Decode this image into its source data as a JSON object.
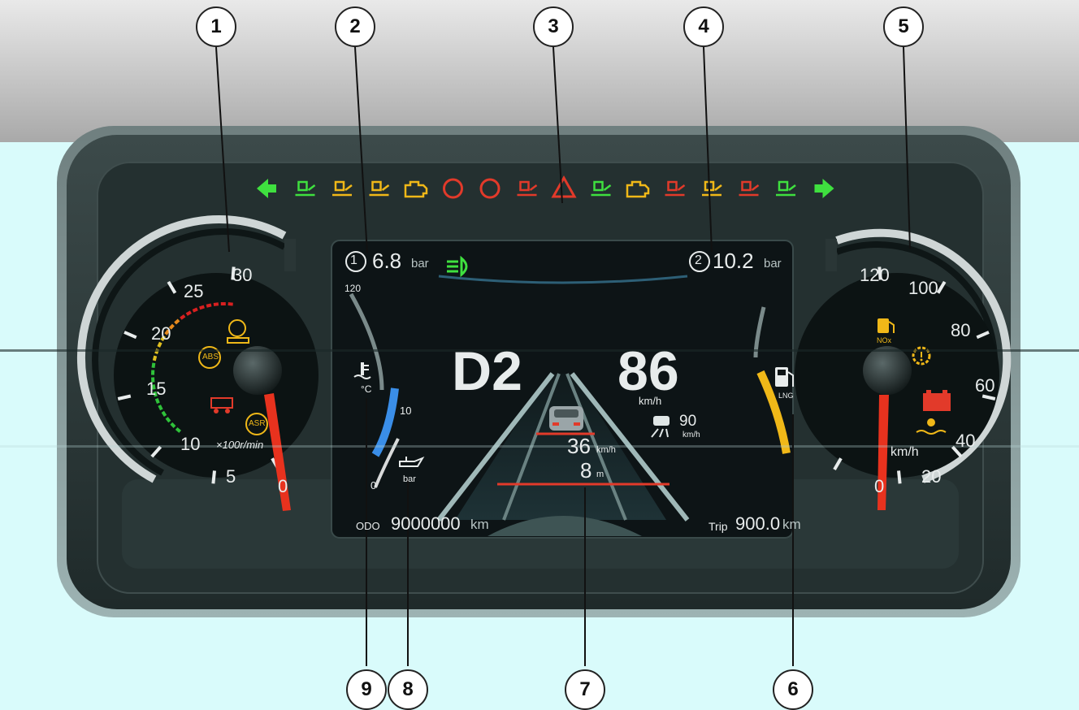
{
  "callouts": [
    "1",
    "2",
    "3",
    "4",
    "5",
    "6",
    "7",
    "8",
    "9"
  ],
  "info_display": {
    "circuit1_symbol": "1",
    "circuit1_value": "6.8",
    "circuit2_symbol": "2",
    "circuit2_value": "10.2",
    "pressure_unit": "bar",
    "gear": "D2",
    "speed": "86",
    "speed_unit": "km/h",
    "set_speed": "90",
    "set_speed_unit": "km/h",
    "lead_vehicle_speed": "36",
    "lead_vehicle_speed_unit": "km/h",
    "distance": "8",
    "distance_unit": "m",
    "odo_label": "ODO",
    "odo_value": "9000000",
    "odo_unit": "km",
    "trip_label": "Trip",
    "trip_value": "900.0",
    "trip_unit": "km"
  },
  "tachometer": {
    "ticks": [
      "30",
      "25",
      "20",
      "15",
      "10",
      "5",
      "0"
    ],
    "unit": "×100r/min",
    "abs_label": "ABS",
    "asr_label": "ASR"
  },
  "speedometer": {
    "ticks": [
      "120",
      "100",
      "80",
      "60",
      "40",
      "20",
      "0"
    ],
    "unit": "km/h",
    "nox_label": "NOx"
  },
  "side_gauges": {
    "coolant_max": "120",
    "coolant_unit": "°C",
    "oil_mark": "10",
    "oil_mark_low": "0",
    "oil_unit": "bar",
    "fuel_label": "LNG"
  },
  "colors": {
    "green_indicator": "#3fe03f",
    "amber_indicator": "#f0b818",
    "red_indicator": "#e23a2a",
    "needle": "#e8321e",
    "background": "#d9fbfb"
  }
}
